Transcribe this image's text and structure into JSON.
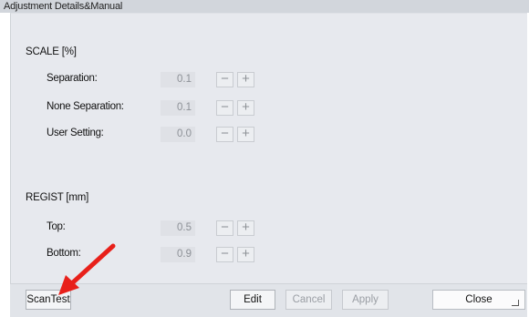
{
  "window": {
    "title": "Adjustment Details&Manual"
  },
  "scale": {
    "title": "SCALE [%]",
    "rows": [
      {
        "label": "Separation:",
        "value": "0.1"
      },
      {
        "label": "None Separation:",
        "value": "0.1"
      },
      {
        "label": "User Setting:",
        "value": "0.0"
      }
    ]
  },
  "regist": {
    "title": "REGIST [mm]",
    "rows": [
      {
        "label": "Top:",
        "value": "0.5"
      },
      {
        "label": "Bottom:",
        "value": "0.9"
      }
    ]
  },
  "stepper": {
    "minus": "−",
    "plus": "+"
  },
  "buttons": {
    "scantest": "ScanTest",
    "edit": "Edit",
    "cancel": "Cancel",
    "apply": "Apply",
    "close": "Close"
  },
  "colors": {
    "annotation_arrow": "#e8201a"
  }
}
